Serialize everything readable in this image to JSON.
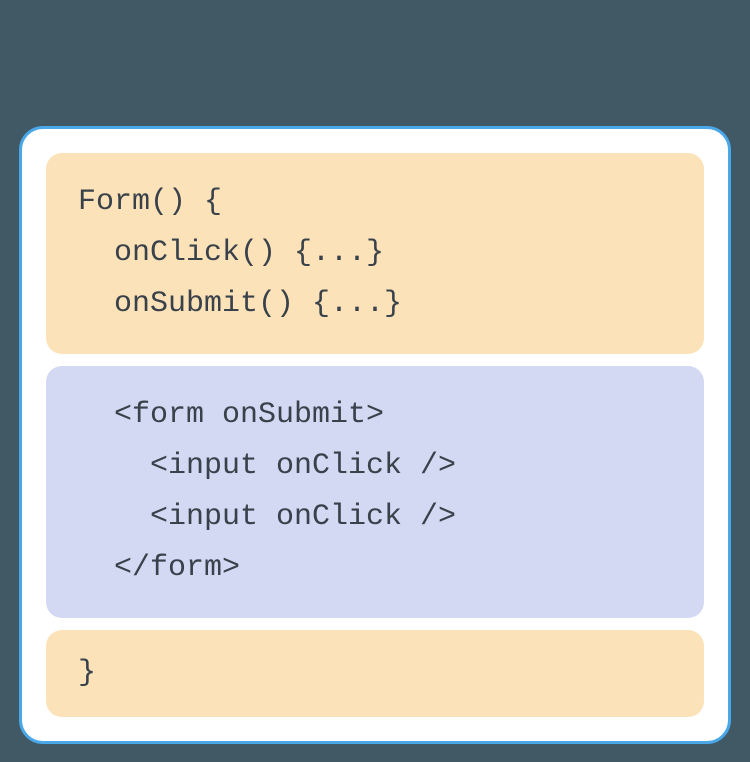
{
  "colors": {
    "background": "#405965",
    "card_bg": "#ffffff",
    "card_border": "#4aa7e8",
    "block_peach": "#fce2b8",
    "block_lavender": "#d3d8f3",
    "text": "#39414a"
  },
  "blocks": {
    "top": {
      "line1": "Form() {",
      "line2": "  onClick() {...}",
      "line3": "  onSubmit() {...}"
    },
    "middle": {
      "line1": "  <form onSubmit>",
      "line2": "    <input onClick />",
      "line3": "    <input onClick />",
      "line4": "  </form>"
    },
    "bottom": {
      "line1": "}"
    }
  }
}
